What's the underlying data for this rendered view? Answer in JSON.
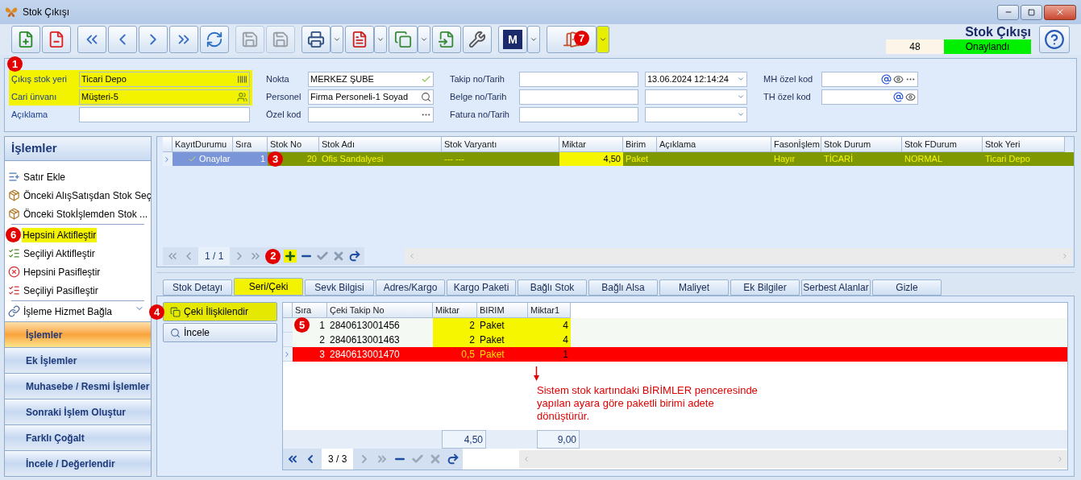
{
  "window": {
    "title": "Stok Çıkışı"
  },
  "toolbar": {
    "buttons": [
      {
        "kind": "new",
        "disabled": false
      },
      {
        "kind": "delete",
        "disabled": false
      },
      {
        "kind": "first",
        "disabled": false
      },
      {
        "kind": "prev",
        "disabled": false
      },
      {
        "kind": "next",
        "disabled": false
      },
      {
        "kind": "last",
        "disabled": false
      },
      {
        "kind": "refresh",
        "disabled": false
      },
      {
        "kind": "save",
        "disabled": true
      },
      {
        "kind": "save_close",
        "disabled": true
      },
      {
        "kind": "print",
        "disabled": false
      },
      {
        "kind": "pdf",
        "disabled": false
      },
      {
        "kind": "copy",
        "disabled": false
      },
      {
        "kind": "import",
        "disabled": false
      },
      {
        "kind": "settings",
        "disabled": false
      },
      {
        "kind": "letter",
        "label": "M",
        "disabled": false
      },
      {
        "kind": "exit",
        "badge": "7",
        "disabled": false
      }
    ]
  },
  "document": {
    "title": "Stok Çıkışı",
    "number": "48",
    "status": "Onaylandı"
  },
  "header": {
    "badge": "1",
    "columns": [
      [
        {
          "kind": "text",
          "label": "Çıkış stok yeri",
          "value": "Ticari Depo",
          "highlighted": true
        },
        {
          "kind": "text",
          "label": "Cari ünvanı",
          "value": "Müşteri-5",
          "highlighted": true
        },
        {
          "kind": "text",
          "label": "Açıklama",
          "highlighted": false
        }
      ],
      [
        {
          "kind": "text",
          "label": "Nokta",
          "value": "MERKEZ ŞUBE",
          "highlighted": false
        },
        {
          "kind": "text",
          "label": "Personel",
          "value": "Firma Personeli-1 Soyad",
          "highlighted": false
        },
        {
          "kind": "text",
          "label": "Özel kod",
          "highlighted": false
        }
      ],
      [
        {
          "kind": "text_date",
          "label": "Takip no/Tarih",
          "date": "13.06.2024 12:14:24",
          "highlighted": false
        },
        {
          "kind": "text_date",
          "label": "Belge no/Tarih",
          "highlighted": false
        },
        {
          "kind": "text_date",
          "label": "Fatura no/Tarih",
          "highlighted": false
        }
      ],
      [
        {
          "kind": "text",
          "label": "MH özel kod",
          "highlighted": false
        },
        {
          "kind": "text",
          "label": "TH özel kod",
          "highlighted": false
        }
      ]
    ]
  },
  "sidebar": {
    "title": "İşlemler",
    "items": [
      {
        "label": "Satır Ekle",
        "highlighted": false,
        "separator_after": false
      },
      {
        "label": "Önceki AlışSatışdan Stok Seç",
        "highlighted": false,
        "separator_after": false
      },
      {
        "label": "Önceki Stokİşlemden Stok ...",
        "highlighted": false,
        "separator_after": true
      },
      {
        "label": "Hepsini Aktifleştir",
        "highlighted": true,
        "badge": "6",
        "separator_after": false
      },
      {
        "label": "Seçiliyi Aktifleştir",
        "highlighted": false,
        "separator_after": false
      },
      {
        "label": "Hepsini Pasifleştir",
        "highlighted": false,
        "separator_after": false
      },
      {
        "label": "Seçiliyi Pasifleştir",
        "highlighted": false,
        "separator_after": true
      },
      {
        "label": "İşleme Hizmet Bağla",
        "highlighted": false,
        "separator_after": false
      }
    ],
    "groups": [
      {
        "label": "İşlemler",
        "selected": true
      },
      {
        "label": "Ek İşlemler",
        "selected": false
      },
      {
        "label": "Muhasebe / Resmi İşlemler",
        "selected": false
      },
      {
        "label": "Sonraki İşlem Oluştur",
        "selected": false
      },
      {
        "label": "Farklı Çoğalt",
        "selected": false
      },
      {
        "label": "İncele / Değerlendir",
        "selected": false
      }
    ]
  },
  "items_grid": {
    "columns": [
      "KayıtDurumu",
      "Sıra",
      "Stok No",
      "Stok Adı",
      "Stok Varyantı",
      "Miktar",
      "Birim",
      "Açıklama",
      "Fasonİşlem",
      "Stok Durum",
      "Stok FDurum",
      "Stok Yeri"
    ],
    "rows": [
      {
        "selected": true,
        "badge": "3",
        "cells": [
          "Onaylar",
          "1",
          "20",
          "Ofis Sandalyesi",
          "--- ---",
          "4,50",
          "Paket",
          "",
          "Hayır",
          "TİCARİ",
          "NORMAL",
          "Ticari Depo"
        ]
      }
    ],
    "pager": "1 / 1",
    "pager_badge": "2"
  },
  "tabs": [
    {
      "label": "Stok Detayı",
      "selected": false
    },
    {
      "label": "Seri/Çeki",
      "selected": true
    },
    {
      "label": "Sevk Bilgisi",
      "selected": false
    },
    {
      "label": "Adres/Kargo",
      "selected": false
    },
    {
      "label": "Kargo Paketi",
      "selected": false
    },
    {
      "label": "Bağlı Stok",
      "selected": false
    },
    {
      "label": "Bağlı Alsa",
      "selected": false
    },
    {
      "label": "Maliyet",
      "selected": false
    },
    {
      "label": "Ek Bilgiler",
      "selected": false
    },
    {
      "label": "Serbest Alanlar",
      "selected": false
    },
    {
      "label": "Gizle",
      "selected": false
    }
  ],
  "side_buttons": [
    {
      "label": "Çeki İlişkilendir",
      "highlighted": true,
      "badge": "4"
    },
    {
      "label": "İncele",
      "highlighted": false
    }
  ],
  "serial_grid": {
    "badge": "5",
    "columns": [
      "Sıra",
      "Çeki Takip No",
      "Miktar",
      "BIRIM",
      "Miktar1"
    ],
    "rows": [
      {
        "selected": false,
        "cells": [
          "1",
          "2840613001456",
          "2",
          "Paket",
          "4"
        ]
      },
      {
        "selected": false,
        "cells": [
          "2",
          "2840613001463",
          "2",
          "Paket",
          "4"
        ]
      },
      {
        "selected": true,
        "cells": [
          "3",
          "2840613001470",
          "0,5",
          "Paket",
          "1"
        ]
      }
    ],
    "totals": {
      "Miktar": "4,50",
      "Miktar1": "9,00"
    },
    "pager": "3 / 3"
  },
  "note": "Sistem stok kartındaki BİRİMLER penceresinde yapılan ayara göre paketli birimi adete dönüştürür."
}
